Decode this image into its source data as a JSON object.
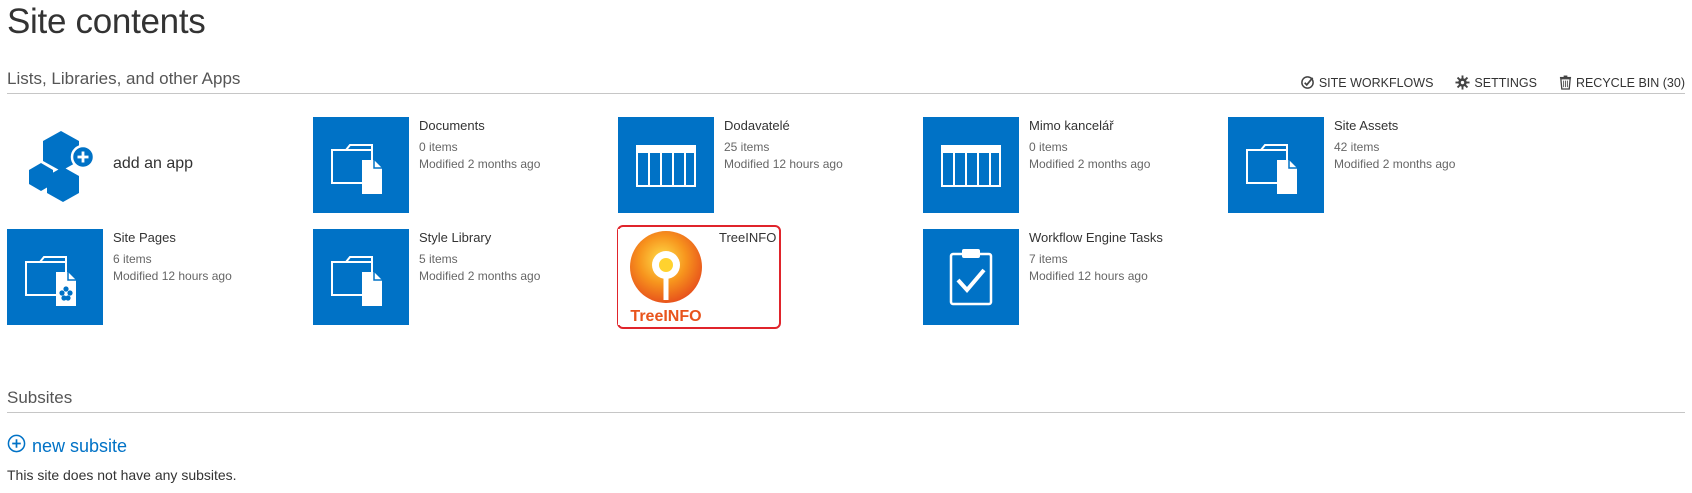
{
  "page": {
    "title": "Site contents"
  },
  "apps_section": {
    "title": "Lists, Libraries, and other Apps",
    "actions": {
      "site_workflows": "SITE WORKFLOWS",
      "settings": "SETTINGS",
      "recycle_bin": "RECYCLE BIN (30)"
    }
  },
  "add_app": {
    "label": "add an app"
  },
  "tiles": [
    {
      "name": "Documents",
      "items": "0 items",
      "modified": "Modified 2 months ago",
      "icon": "document-library-icon"
    },
    {
      "name": "Dodavatelé",
      "items": "25 items",
      "modified": "Modified 12 hours ago",
      "icon": "list-icon"
    },
    {
      "name": "Mimo kancelář",
      "items": "0 items",
      "modified": "Modified 2 months ago",
      "icon": "list-icon"
    },
    {
      "name": "Site Assets",
      "items": "42 items",
      "modified": "Modified 2 months ago",
      "icon": "document-library-icon"
    },
    {
      "name": "Site Pages",
      "items": "6 items",
      "modified": "Modified 12 hours ago",
      "icon": "site-pages-icon"
    },
    {
      "name": "Style Library",
      "items": "5 items",
      "modified": "Modified 2 months ago",
      "icon": "document-library-icon"
    },
    {
      "name": "TreeINFO",
      "logo_text": "TreeINFO",
      "icon": "treeinfo-logo-icon"
    },
    {
      "name": "Workflow Engine Tasks",
      "items": "7 items",
      "modified": "Modified 12 hours ago",
      "icon": "tasks-icon"
    }
  ],
  "subsites_section": {
    "title": "Subsites",
    "new_subsite": "new subsite",
    "empty_message": "This site does not have any subsites."
  },
  "colors": {
    "tile_blue": "#0072c6",
    "highlight_red": "#e0242b",
    "logo_orange": "#e8541c",
    "link_blue": "#0072c6"
  }
}
